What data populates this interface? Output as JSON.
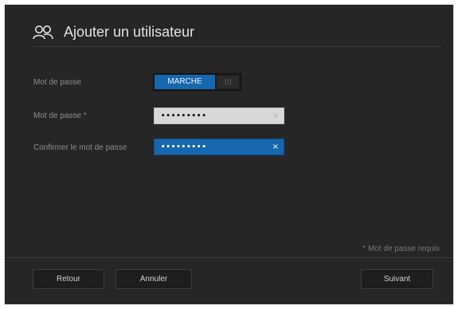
{
  "header": {
    "title": "Ajouter un utilisateur",
    "icon": "users-icon"
  },
  "form": {
    "password_toggle": {
      "label": "Mot de passe",
      "state": "MARCHE",
      "on": true
    },
    "password": {
      "label": "Mot de passe *",
      "value": "•••••••••",
      "clear_icon": "×"
    },
    "confirm_password": {
      "label": "Confirmer le mot de passe",
      "value": "•••••••••",
      "clear_icon": "×"
    },
    "footnote": "* Mot de passe requis"
  },
  "footer": {
    "back_label": "Retour",
    "cancel_label": "Annuler",
    "next_label": "Suivant"
  },
  "colors": {
    "background": "#262626",
    "accent": "#1667ad"
  }
}
